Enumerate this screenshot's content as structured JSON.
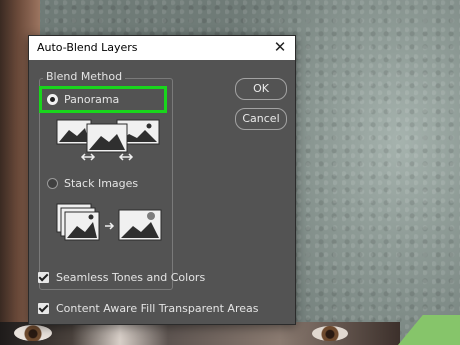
{
  "dialog": {
    "title": "Auto-Blend Layers",
    "close_glyph": "✕",
    "blend_method": {
      "legend": "Blend Method",
      "options": [
        {
          "label": "Panorama",
          "selected": true
        },
        {
          "label": "Stack Images",
          "selected": false
        }
      ]
    },
    "buttons": {
      "ok": "OK",
      "cancel": "Cancel"
    },
    "checkboxes": [
      {
        "label": "Seamless Tones and Colors",
        "checked": true
      },
      {
        "label": "Content Aware Fill Transparent Areas",
        "checked": true
      }
    ]
  },
  "colors": {
    "dialog_bg": "#535353",
    "highlight": "#19d61c"
  },
  "icons": [
    "close-icon",
    "panorama-illustration",
    "stack-images-illustration",
    "check-icon"
  ]
}
